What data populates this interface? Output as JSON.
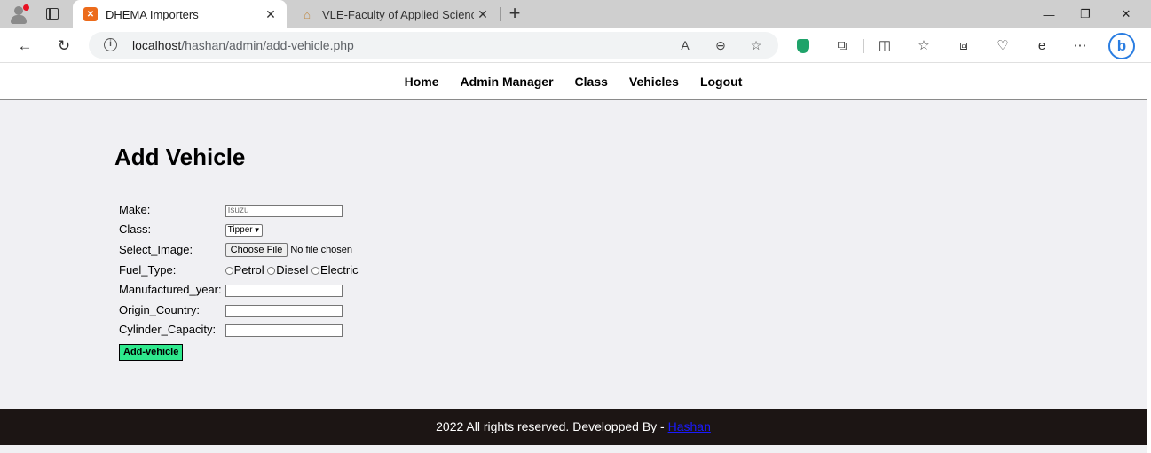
{
  "browser": {
    "tabs": [
      {
        "title": "DHEMA Importers",
        "active": true
      },
      {
        "title": "VLE-Faculty of Applied Science: L",
        "active": false
      }
    ],
    "url_host": "localhost",
    "url_path": "/hashan/admin/add-vehicle.php"
  },
  "nav": {
    "items": [
      "Home",
      "Admin Manager",
      "Class",
      "Vehicles",
      "Logout"
    ]
  },
  "form": {
    "title": "Add Vehicle",
    "make_label": "Make:",
    "make_placeholder": "Isuzu",
    "class_label": "Class:",
    "class_value": "Tipper",
    "image_label": "Select_Image:",
    "choose_file": "Choose File",
    "no_file": "No file chosen",
    "fuel_label": "Fuel_Type:",
    "fuel_options": [
      "Petrol",
      "Diesel",
      "Electric"
    ],
    "year_label": "Manufactured_year:",
    "origin_label": "Origin_Country:",
    "cylinder_label": "Cylinder_Capacity:",
    "submit_label": "Add-vehicle"
  },
  "footer": {
    "text": "2022 All rights reserved. Developped By - ",
    "link": "Hashan"
  },
  "colors": {
    "submit_bg": "#2ee88d",
    "footer_bg": "#1c1514",
    "page_bg": "#f0f0f3"
  }
}
